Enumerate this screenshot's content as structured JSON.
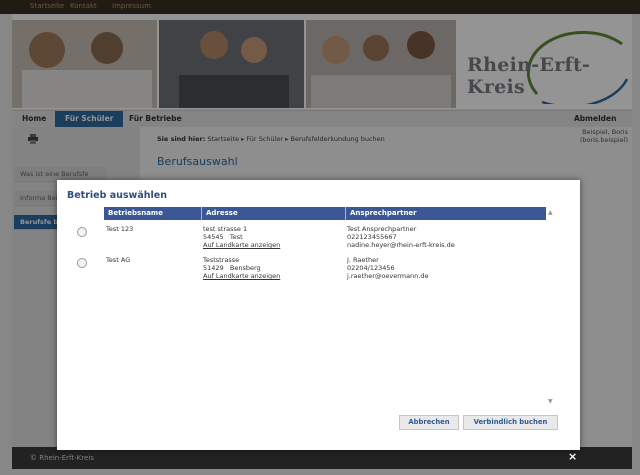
{
  "topbar": {
    "links": [
      "Startseite",
      "Kontakt",
      "Impressum"
    ]
  },
  "logo": {
    "text": "Rhein-Erft-Kreis"
  },
  "nav": {
    "home": "Home",
    "fuer_schueler": "Für Schüler",
    "fuer_betriebe": "Für Betriebe",
    "abmelden": "Abmelden"
  },
  "breadcrumb": {
    "label": "Sie sind hier:",
    "items": [
      "Startseite",
      "Für Schüler",
      "Berufsfelderkundung buchen"
    ]
  },
  "user": {
    "name": "Beispiel, Boris",
    "login": "(boris.beispiel)"
  },
  "section_title": "Berufsauswahl",
  "sidebar": {
    "items": [
      {
        "label": "Was ist eine Berufsfe"
      },
      {
        "label": "Informa Berufsfe"
      },
      {
        "label": "Berufsfe buchen"
      }
    ]
  },
  "footer": {
    "copyright": "© Rhein-Erft-Kreis",
    "close": "×"
  },
  "modal": {
    "title": "Betrieb auswählen",
    "columns": [
      "Betriebsname",
      "Adresse",
      "Ansprechpartner"
    ],
    "rows": [
      {
        "name": "Test 123",
        "street": "test strasse 1",
        "city": "54545   Test",
        "map_link": "Auf Landkarte anzeigen",
        "contact": "Test Ansprechpartner",
        "phone": "022123455667",
        "email": "nadine.heyer@rhein-erft-kreis.de"
      },
      {
        "name": "Test AG",
        "street": "Teststrasse",
        "city": "51429   Bensberg",
        "map_link": "Auf Landkarte anzeigen",
        "contact": "J. Raether",
        "phone": "02204/123456",
        "email": "j.raether@oevermann.de"
      }
    ],
    "cancel_button": "Abbrechen",
    "book_button": "Verbindlich buchen",
    "scroll_up": "▲",
    "scroll_down": "▼"
  },
  "colors": {
    "brand_blue": "#2f6aa3",
    "table_header": "#3b5795",
    "topbar": "#3a2f22"
  }
}
